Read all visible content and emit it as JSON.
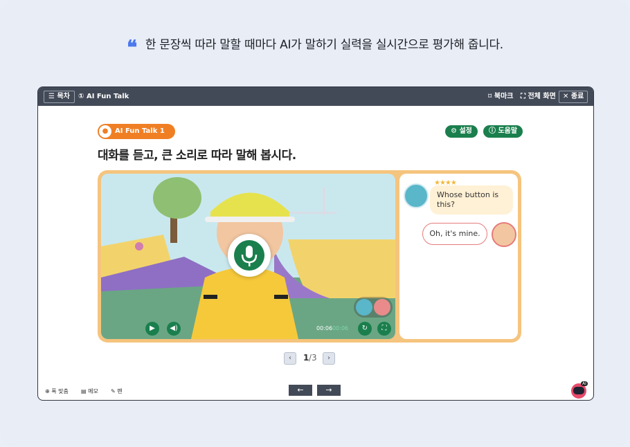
{
  "headline": {
    "quote_mark": "❝",
    "text": "한 문장씩 따라 말할 때마다 AI가 말하기 실력을 실시간으로 평가해 줍니다."
  },
  "topbar": {
    "toc_label": "목차",
    "title": "① AI Fun Talk",
    "bookmark_label": "북마크",
    "fullscreen_label": "전체 화면",
    "close_label": "종료"
  },
  "lesson": {
    "badge": "AI Fun Talk 1",
    "instruction": "대화를 듣고, 큰 소리로 따라 말해 봅시다.",
    "settings_label": "설정",
    "help_label": "도움말"
  },
  "video": {
    "time_current": "00:06",
    "time_total": "00:06"
  },
  "chat": {
    "star_rating": 4,
    "stars_glyph": "★★★★",
    "messages": [
      {
        "speaker": "left",
        "text": "Whose button is this?"
      },
      {
        "speaker": "right",
        "text": "Oh, it's mine."
      }
    ]
  },
  "pager": {
    "current": "1",
    "total": "/3"
  },
  "bottom": {
    "fit_label": "폭 맞춤",
    "memo_label": "메모",
    "pen_label": "펜",
    "prev": "←",
    "next": "→",
    "ai_tag": "AI"
  },
  "colors": {
    "accent_green": "#1a7f4d",
    "accent_orange": "#f07f24",
    "frame": "#f5c47e",
    "quote_blue": "#4a78ee"
  }
}
